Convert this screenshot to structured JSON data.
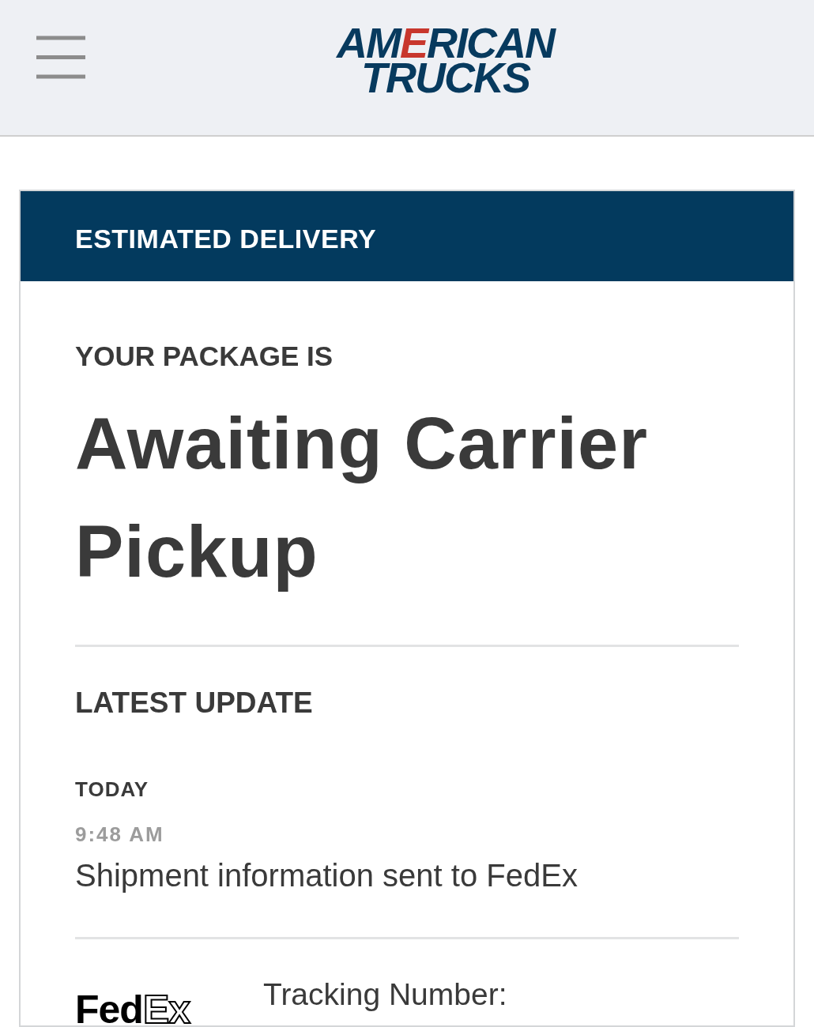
{
  "header": {
    "logo": {
      "line_1": "AMERICAN",
      "line_2": "TRUCKS"
    }
  },
  "delivery_card": {
    "title": "ESTIMATED DELIVERY",
    "status_label": "YOUR PACKAGE IS",
    "status": "Awaiting Carrier Pickup",
    "latest_update": {
      "heading": "LATEST UPDATE",
      "day": "TODAY",
      "time": "9:48 AM",
      "message": "Shipment information sent to FedEx"
    },
    "carrier": {
      "logo": "FedEx",
      "tracking_label": "Tracking Number:"
    }
  }
}
